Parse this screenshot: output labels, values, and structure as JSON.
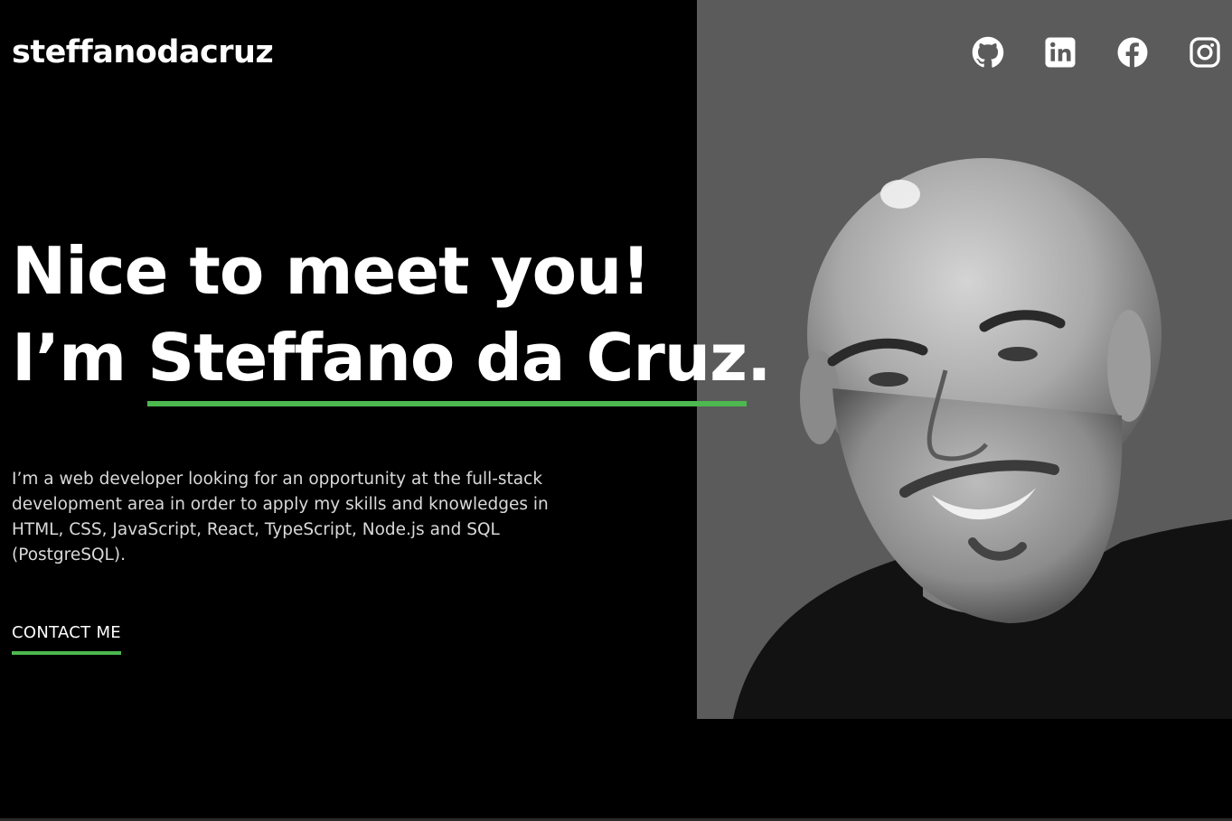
{
  "brand": {
    "logo_text": "steffanodacruz"
  },
  "social_links": [
    {
      "label": "GitHub",
      "icon": "github-icon"
    },
    {
      "label": "LinkedIn",
      "icon": "linkedin-icon"
    },
    {
      "label": "Facebook",
      "icon": "facebook-icon"
    },
    {
      "label": "Instagram",
      "icon": "instagram-icon"
    }
  ],
  "hero": {
    "greeting": "Nice to meet you!",
    "im_prefix": "I’m ",
    "name": "Steffano da Cruz",
    "name_suffix": ".",
    "intro": "I’m a web developer looking for an opportunity at the full-stack development area in order to apply my skills and knowledges in HTML, CSS, JavaScript, React, TypeScript, Node.js and SQL (PostgreSQL).",
    "cta_label": "CONTACT ME",
    "photo_description_icon": "portrait-photo"
  },
  "colors": {
    "background": "#000000",
    "photo_panel": "#5b5b5b",
    "accent_green": "#4cb84f",
    "text": "#ffffff",
    "muted_text": "#d9d9d9"
  }
}
